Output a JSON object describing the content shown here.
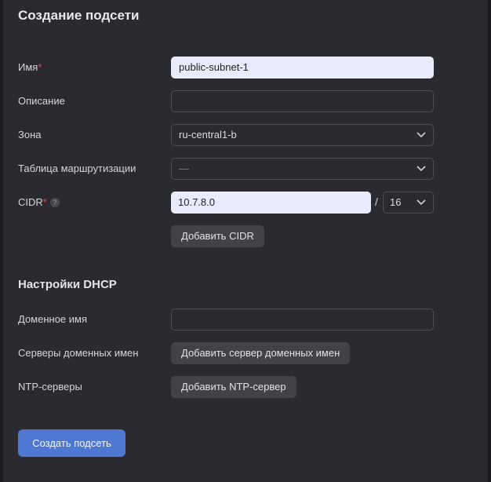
{
  "form": {
    "title": "Создание подсети",
    "name": {
      "label": "Имя",
      "required_mark": "*",
      "value": "public-subnet-1"
    },
    "description": {
      "label": "Описание",
      "value": ""
    },
    "zone": {
      "label": "Зона",
      "value": "ru-central1-b"
    },
    "route_table": {
      "label": "Таблица маршрутизации",
      "value": "—"
    },
    "cidr": {
      "label": "CIDR",
      "required_mark": "*",
      "help": "?",
      "value": "10.7.8.0",
      "separator": "/",
      "mask": "16",
      "add_button": "Добавить CIDR"
    }
  },
  "dhcp": {
    "title": "Настройки DHCP",
    "domain_name": {
      "label": "Доменное имя",
      "value": ""
    },
    "dns_servers": {
      "label": "Серверы доменных имен",
      "add_button": "Добавить сервер доменных имен"
    },
    "ntp_servers": {
      "label": "NTP-серверы",
      "add_button": "Добавить NTP-сервер"
    }
  },
  "actions": {
    "create_button": "Создать подсеть"
  },
  "icons": {
    "dropdown": "chevron-down-icon",
    "help": "question-circle-icon"
  },
  "colors": {
    "primary": "#4e78d1",
    "required": "#e5484d",
    "panel_bg": "#2b2a30"
  }
}
